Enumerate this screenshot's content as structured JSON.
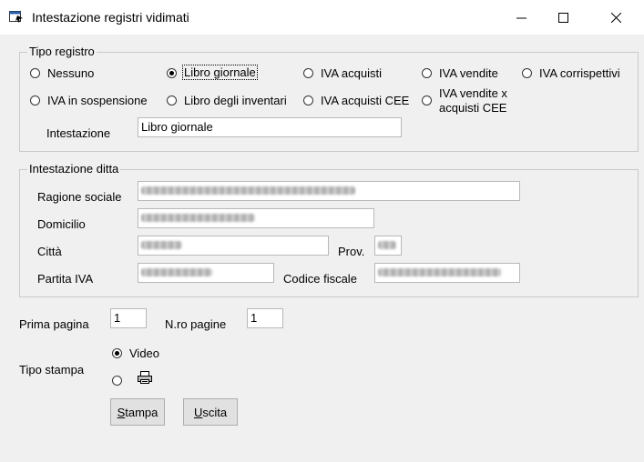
{
  "window": {
    "title": "Intestazione registri vidimati",
    "minimize_glyph": "—",
    "maximize_glyph": "☐",
    "close_glyph": "✕"
  },
  "tipo_registro": {
    "legend": "Tipo registro",
    "options": [
      {
        "label": "Nessuno",
        "selected": false
      },
      {
        "label": "Libro giornale",
        "selected": true
      },
      {
        "label": "IVA acquisti",
        "selected": false
      },
      {
        "label": "IVA vendite",
        "selected": false
      },
      {
        "label": "IVA corrispettivi",
        "selected": false
      },
      {
        "label": "IVA in sospensione",
        "selected": false
      },
      {
        "label": "Libro degli inventari",
        "selected": false
      },
      {
        "label": "IVA acquisti CEE",
        "selected": false
      },
      {
        "label": "IVA vendite x acquisti CEE",
        "selected": false
      }
    ],
    "intestazione_label": "Intestazione",
    "intestazione_value": "Libro giornale"
  },
  "intestazione_ditta": {
    "legend": "Intestazione ditta",
    "ragione_sociale_label": "Ragione sociale",
    "domicilio_label": "Domicilio",
    "citta_label": "Città",
    "prov_label": "Prov.",
    "partita_iva_label": "Partita IVA",
    "codice_fiscale_label": "Codice fiscale"
  },
  "pagine": {
    "prima_pagina_label": "Prima pagina",
    "prima_pagina_value": "1",
    "nro_pagine_label": "N.ro pagine",
    "nro_pagine_value": "1"
  },
  "tipo_stampa": {
    "label": "Tipo stampa",
    "video_label": "Video",
    "video_selected": true,
    "printer_icon": "printer-icon"
  },
  "buttons": {
    "stampa_first": "S",
    "stampa_rest": "tampa",
    "uscita_first": "U",
    "uscita_rest": "scita"
  }
}
